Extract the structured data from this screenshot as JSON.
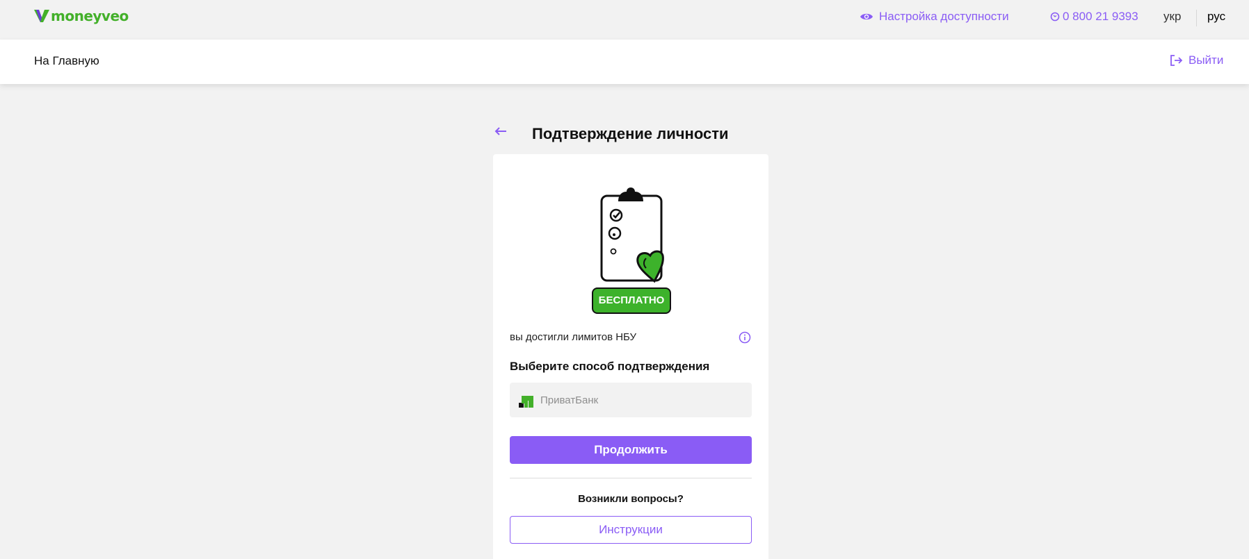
{
  "header": {
    "logo_text": "moneyveo",
    "accessibility_label": "Настройка доступности",
    "phone": "0 800 21 9393",
    "lang_ukr": "укр",
    "lang_rus": "рус"
  },
  "nav": {
    "home_label": "На Главную",
    "logout_label": "Выйти"
  },
  "page": {
    "title": "Подтверждение личности"
  },
  "card": {
    "badge": "БЕСПЛАТНО",
    "limit_text": "вы достигли лимитов НБУ",
    "choose_title": "Выберите способ подтверждения",
    "bank_name": "ПриватБанк",
    "continue_label": "Продолжить",
    "questions_label": "Возникли вопросы?",
    "instructions_label": "Инструкции"
  },
  "colors": {
    "accent": "#8a5cf5",
    "brand_green": "#43b02a",
    "badge_green": "#3db22b",
    "background": "#f2f2f2"
  }
}
